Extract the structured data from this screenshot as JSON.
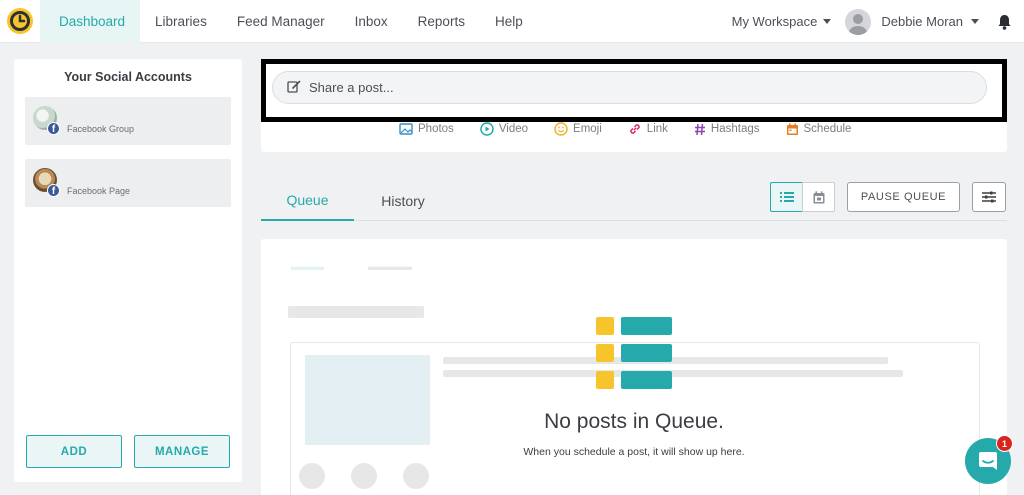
{
  "nav": {
    "items": [
      {
        "label": "Dashboard",
        "active": true
      },
      {
        "label": "Libraries"
      },
      {
        "label": "Feed Manager"
      },
      {
        "label": "Inbox"
      },
      {
        "label": "Reports"
      },
      {
        "label": "Help"
      }
    ],
    "workspace": "My Workspace",
    "user_name": "Debbie Moran"
  },
  "sidebar": {
    "title": "Your Social Accounts",
    "accounts": [
      {
        "label": "Facebook Group",
        "network_icon": "facebook-icon"
      },
      {
        "label": "Facebook Page",
        "network_icon": "facebook-icon"
      }
    ],
    "add_label": "ADD",
    "manage_label": "MANAGE"
  },
  "composer": {
    "placeholder": "Share a post...",
    "actions": [
      {
        "label": "Photos",
        "icon": "photo-icon",
        "color": "#3b8ec9"
      },
      {
        "label": "Video",
        "icon": "play-icon",
        "color": "#26a9aa"
      },
      {
        "label": "Emoji",
        "icon": "emoji-icon",
        "color": "#f0b429"
      },
      {
        "label": "Link",
        "icon": "link-icon",
        "color": "#e0245e"
      },
      {
        "label": "Hashtags",
        "icon": "hashtag-icon",
        "color": "#8e44ad"
      },
      {
        "label": "Schedule",
        "icon": "calendar-icon",
        "color": "#e67e22"
      }
    ]
  },
  "tabs": [
    {
      "label": "Queue",
      "active": true
    },
    {
      "label": "History"
    }
  ],
  "toolbar": {
    "pause_label": "PAUSE QUEUE"
  },
  "queue": {
    "empty_title": "No posts in Queue.",
    "empty_subtitle": "When you schedule a post, it will show up here."
  },
  "chat": {
    "badge_count": "1"
  },
  "colors": {
    "accent": "#26a9aa",
    "icon_yellow": "#f7c52b"
  }
}
